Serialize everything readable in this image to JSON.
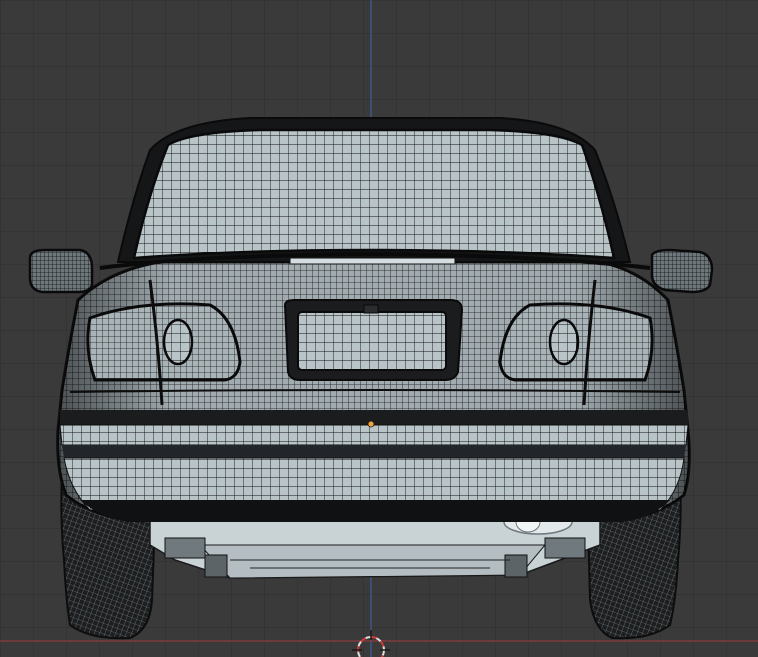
{
  "viewport": {
    "background": "#3a3a3a",
    "grid_color": "#2e2e2e",
    "axis_x_color": "#9c3b3b",
    "axis_z_color": "#3d5f9c",
    "origin_color": "#f2a33a",
    "cursor_color": "#e0e0e0",
    "cursor_accent": "#d23a3a"
  },
  "model": {
    "mesh_light": "#b9c4c9",
    "mesh_mid": "#8f9aa0",
    "mesh_dark": "#1b1d1e",
    "wire": "#111111",
    "underbody": "#c9d3d6",
    "exhaust": "#e3e8ea"
  },
  "icons": {
    "origin": "object-origin-icon",
    "cursor": "3d-cursor-icon"
  }
}
